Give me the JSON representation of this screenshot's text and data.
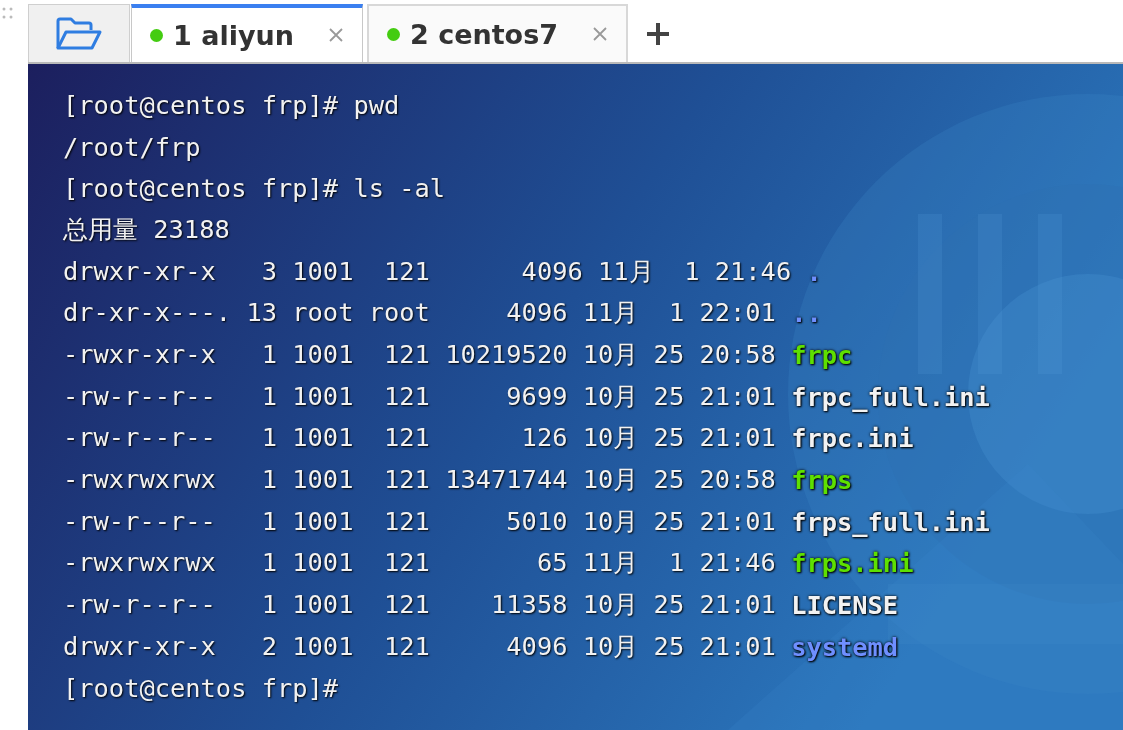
{
  "tabs": [
    {
      "label": "1 aliyun",
      "selected": true,
      "connected": true
    },
    {
      "label": "2 centos7",
      "selected": false,
      "connected": true
    }
  ],
  "terminal": {
    "lines": [
      {
        "kind": "text",
        "text": "[root@centos frp]# pwd"
      },
      {
        "kind": "text",
        "text": "/root/frp"
      },
      {
        "kind": "text",
        "text": "[root@centos frp]# ls -al"
      },
      {
        "kind": "text",
        "text": "总用量 23188"
      },
      {
        "kind": "entry",
        "meta": "drwxr-xr-x   3 1001  121      4096 11月  1 21:46",
        "name": ".",
        "color": "#6f8fff"
      },
      {
        "kind": "entry",
        "meta": "dr-xr-x---. 13 root root     4096 11月  1 22:01",
        "name": "..",
        "color": "#6f8fff"
      },
      {
        "kind": "entry",
        "meta": "-rwxr-xr-x   1 1001  121 10219520 10月 25 20:58",
        "name": "frpc",
        "color": "#5ee000"
      },
      {
        "kind": "entry",
        "meta": "-rw-r--r--   1 1001  121     9699 10月 25 21:01",
        "name": "frpc_full.ini",
        "color": "#f2f2f2"
      },
      {
        "kind": "entry",
        "meta": "-rw-r--r--   1 1001  121      126 10月 25 21:01",
        "name": "frpc.ini",
        "color": "#f2f2f2"
      },
      {
        "kind": "entry",
        "meta": "-rwxrwxrwx   1 1001  121 13471744 10月 25 20:58",
        "name": "frps",
        "color": "#5ee000"
      },
      {
        "kind": "entry",
        "meta": "-rw-r--r--   1 1001  121     5010 10月 25 21:01",
        "name": "frps_full.ini",
        "color": "#f2f2f2"
      },
      {
        "kind": "entry",
        "meta": "-rwxrwxrwx   1 1001  121       65 11月  1 21:46",
        "name": "frps.ini",
        "color": "#5ee000"
      },
      {
        "kind": "entry",
        "meta": "-rw-r--r--   1 1001  121    11358 10月 25 21:01",
        "name": "LICENSE",
        "color": "#f2f2f2"
      },
      {
        "kind": "entry",
        "meta": "drwxr-xr-x   2 1001  121     4096 10月 25 21:01",
        "name": "systemd",
        "color": "#6f8fff"
      },
      {
        "kind": "text",
        "text": "[root@centos frp]#"
      }
    ]
  }
}
